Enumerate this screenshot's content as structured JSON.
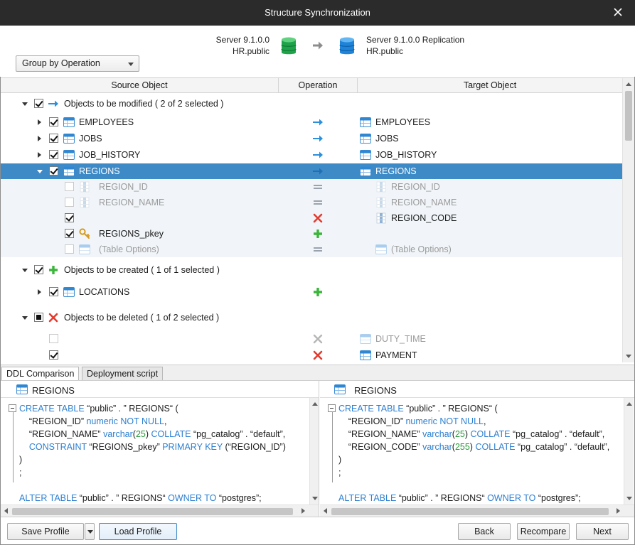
{
  "window": {
    "title": "Structure Synchronization"
  },
  "header": {
    "group_by": "Group by Operation",
    "source": {
      "server": "Server 9.1.0.0",
      "database": "HR.public"
    },
    "target": {
      "server": "Server 9.1.0.0 Replication",
      "database": "HR.public"
    }
  },
  "grid": {
    "columns": [
      "Source Object",
      "Operation",
      "Target Object"
    ],
    "groups": {
      "modified": "Objects to be modified ( 2 of 2 selected )",
      "created": "Objects to be created ( 1 of 1 selected )",
      "deleted": "Objects to be deleted ( 1 of 2 selected )"
    },
    "rows": {
      "employees": {
        "source": "EMPLOYEES",
        "target": "EMPLOYEES"
      },
      "jobs": {
        "source": "JOBS",
        "target": "JOBS"
      },
      "job_history": {
        "source": "JOB_HISTORY",
        "target": "JOB_HISTORY"
      },
      "regions": {
        "source": "REGIONS",
        "target": "REGIONS"
      },
      "region_id": {
        "source": "REGION_ID",
        "target": "REGION_ID"
      },
      "region_name": {
        "source": "REGION_NAME",
        "target": "REGION_NAME"
      },
      "region_code": {
        "source": "",
        "target": "REGION_CODE"
      },
      "regions_pkey": {
        "source": "REGIONS_pkey",
        "target": ""
      },
      "table_options": {
        "source": "(Table Options)",
        "target": "(Table Options)"
      },
      "locations": {
        "source": "LOCATIONS",
        "target": ""
      },
      "duty_time": {
        "source": "",
        "target": "DUTY_TIME"
      },
      "payment": {
        "source": "",
        "target": "PAYMENT"
      }
    }
  },
  "tabs": [
    "DDL Comparison",
    "Deployment script"
  ],
  "ddl": {
    "left": {
      "title": "REGIONS",
      "l1a": "CREATE TABLE",
      "l1b": " “public” . ” REGIONS“ (",
      "l2a": "    “REGION_ID” ",
      "l2b": "numeric NOT NULL",
      "l2c": ",",
      "l3a": "    “REGION_NAME” ",
      "l3b": "varchar",
      "l3c": "(",
      "l3d": "25",
      "l3e": ") ",
      "l3f": "COLLATE",
      "l3g": " “pg_catalog” . “default”,",
      "l4a": "    ",
      "l4b": "CONSTRAINT",
      "l4c": " “REGIONS_pkey” ",
      "l4d": "PRIMARY KEY",
      "l4e": " (“REGION_ID”)",
      "l5": ")",
      "l6": ";",
      "l8a": "ALTER TABLE",
      "l8b": " “public” . ” REGIONS“ ",
      "l8c": "OWNER TO",
      "l8d": " “postgres”;"
    },
    "right": {
      "title": "REGIONS",
      "l1a": "CREATE TABLE",
      "l1b": " “public” . ” REGIONS“ (",
      "l2a": "    “REGION_ID” ",
      "l2b": "numeric NOT NULL",
      "l2c": ",",
      "l3a": "    “REGION_NAME” ",
      "l3b": "varchar",
      "l3c": "(",
      "l3d": "25",
      "l3e": ") ",
      "l3f": "COLLATE",
      "l3g": " “pg_catalog” . “default”,",
      "l4a": "    “REGION_CODE” ",
      "l4b": "varchar",
      "l4c": "(",
      "l4d": "255",
      "l4e": ") ",
      "l4f": "COLLATE",
      "l4g": " “pg_catalog” . “default”,",
      "l5": ")",
      "l6": ";",
      "l8a": "ALTER TABLE",
      "l8b": " “public” . ” REGIONS“ ",
      "l8c": "OWNER TO",
      "l8d": " “postgres”;"
    }
  },
  "footer": {
    "save_profile": "Save Profile",
    "load_profile": "Load Profile",
    "back": "Back",
    "recompare": "Recompare",
    "next": "Next"
  },
  "colors": {
    "selection": "#3d8ac7",
    "keyword": "#2c7fd1",
    "number": "#2c9a3a",
    "arrow": "#2b8fdc",
    "create": "#3bb53b",
    "delete": "#e23b2e",
    "equal": "#9aa3ad"
  }
}
